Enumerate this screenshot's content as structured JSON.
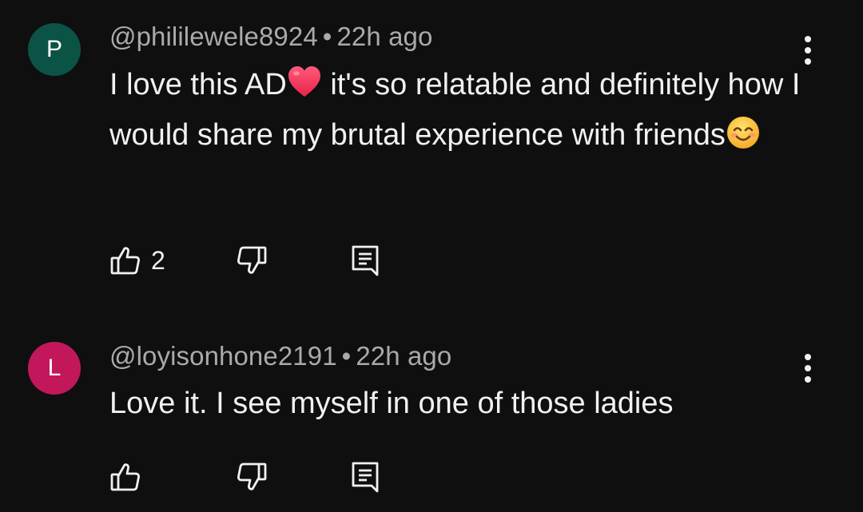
{
  "comments": [
    {
      "avatar_letter": "P",
      "avatar_color": "#0b5345",
      "author": "@phililewele8924",
      "separator": "•",
      "time": "22h ago",
      "text_part1": "I love this AD",
      "emoji1": "red-heart",
      "text_part2": " it's so relatable and definitely how I would share my brutal experience with friends",
      "emoji2": "smiling-face-with-smiling-eyes",
      "like_count": "2",
      "icons": [
        "thumbs-up-icon",
        "thumbs-down-icon",
        "reply-icon",
        "more-vert-icon"
      ]
    },
    {
      "avatar_letter": "L",
      "avatar_color": "#c2185b",
      "author": "@loyisonhone2191",
      "separator": "•",
      "time": "22h ago",
      "text": "Love it. I see myself in one of those ladies",
      "like_count": "",
      "icons": [
        "thumbs-up-icon",
        "thumbs-down-icon",
        "reply-icon",
        "more-vert-icon"
      ]
    }
  ],
  "colors": {
    "background": "#0f0f0f",
    "text": "#f1f1f1",
    "meta": "#aaaaaa"
  }
}
